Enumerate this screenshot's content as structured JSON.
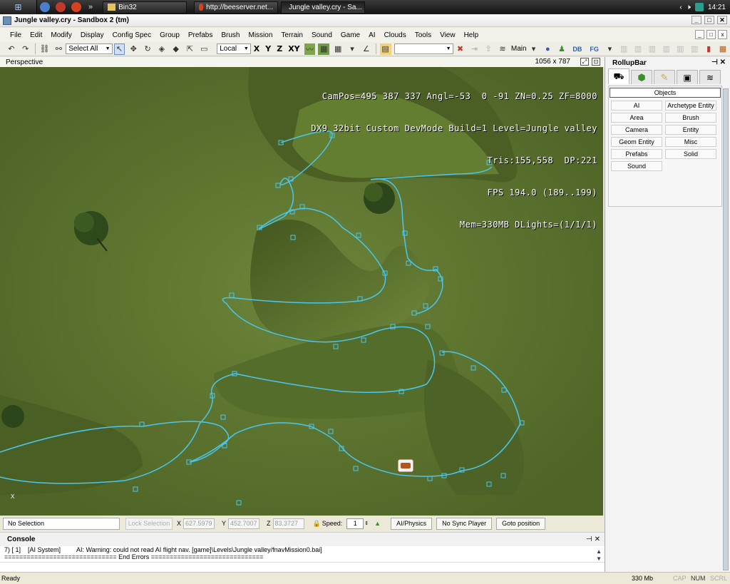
{
  "taskbar": {
    "tasks": [
      {
        "label": "Bin32",
        "active": false
      },
      {
        "label": "http://beeserver.net...",
        "active": false
      },
      {
        "label": "Jungle valley.cry - Sa...",
        "active": true
      }
    ],
    "clock": "14:21"
  },
  "window": {
    "title": "Jungle valley.cry - Sandbox 2 (tm)"
  },
  "menu": [
    "File",
    "Edit",
    "Modify",
    "Display",
    "Config Spec",
    "Group",
    "Prefabs",
    "Brush",
    "Mission",
    "Terrain",
    "Sound",
    "Game",
    "AI",
    "Clouds",
    "Tools",
    "View",
    "Help"
  ],
  "toolbar": {
    "selection_filter": "Select All",
    "coord_space": "Local",
    "axes": [
      "X",
      "Y",
      "Z",
      "XY"
    ],
    "layer_label": "Main"
  },
  "viewport": {
    "name": "Perspective",
    "size_label": "1056 x 787",
    "hud": [
      "CamPos=495 387 337 Angl=-53  0 -91 ZN=0.25 ZF=8000",
      "DX9 32bit Custom DevMode Build=1 Level=Jungle valley",
      "Tris:155,558  DP:221",
      "FPS 194.0 (189..199)",
      "Mem=330MB DLights=(1/1/1)"
    ],
    "axis_label": "X"
  },
  "rollupbar": {
    "title": "RollupBar",
    "header_button": "Objects",
    "buttons": [
      "AI",
      "Archetype Entity",
      "Area",
      "Brush",
      "Camera",
      "Entity",
      "Geom Entity",
      "Misc",
      "Prefabs",
      "Solid",
      "Sound"
    ]
  },
  "controls": {
    "selection": "No Selection",
    "lock_selection": "Lock Selection",
    "x_label": "X",
    "x_value": "627.5979",
    "y_label": "Y",
    "y_value": "452.7007",
    "z_label": "Z",
    "z_value": "83.3727",
    "speed_label": "Speed:",
    "speed_value": "1",
    "ai_physics": "AI/Physics",
    "no_sync_player": "No Sync Player",
    "goto_position": "Goto position"
  },
  "console": {
    "title": "Console",
    "lines": [
      "7) [ 1]    [AI System]         AI: Warning: could not read AI flight nav. [game]\\Levels\\Jungle valley/fnavMission0.bai]",
      "============================== End Errors =============================="
    ]
  },
  "status": {
    "text": "Ready",
    "memory": "330 Mb",
    "caps": "CAP",
    "num": "NUM",
    "scrl": "SCRL"
  },
  "colors": {
    "path_line": "#48c8f0",
    "terrain": "#5e7433",
    "hud_text": "#ffffff"
  }
}
